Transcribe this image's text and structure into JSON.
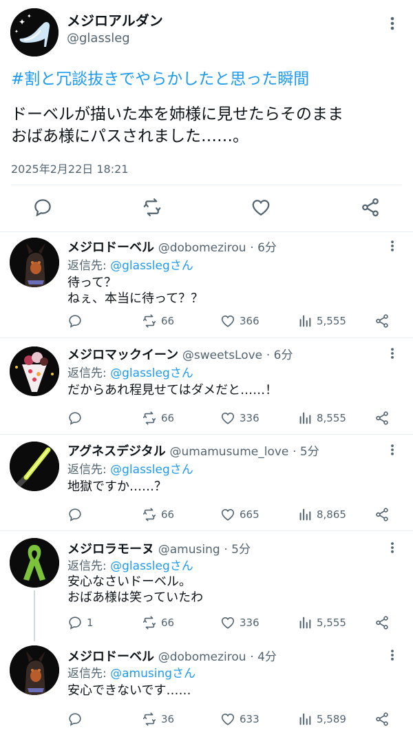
{
  "main": {
    "name": "メジロアルダン",
    "handle": "@glassleg",
    "hashtag": "#割と冗談抜きでやらかしたと思った瞬間",
    "text": "ドーベルが描いた本を姉様に見せたらそのまま\nおばあ様にパスされました……。",
    "timestamp": "2025年2月22日 18:21",
    "icons": [
      "reply-icon",
      "retweet-icon",
      "like-icon",
      "share-icon"
    ]
  },
  "replies": [
    {
      "name": "メジロドーベル",
      "handle": "@dobomezirou",
      "time": "· 6分",
      "reply_prefix": "返信先:",
      "reply_to": "@glasslegさん",
      "text": "待って？\nねぇ、本当に待って？？",
      "replies": "",
      "retweets": "66",
      "likes": "366",
      "views": "5,555"
    },
    {
      "name": "メジロマックイーン",
      "handle": "@sweetsLove",
      "time": "· 6分",
      "reply_prefix": "返信先:",
      "reply_to": "@glasslegさん",
      "text": "だからあれ程見せてはダメだと……！",
      "replies": "",
      "retweets": "66",
      "likes": "336",
      "views": "8,555"
    },
    {
      "name": "アグネスデジタル",
      "handle": "@umamusume_love",
      "time": "· 5分",
      "reply_prefix": "返信先:",
      "reply_to": "@glasslegさん",
      "text": "地獄ですか……？",
      "replies": "",
      "retweets": "66",
      "likes": "665",
      "views": "8,865"
    },
    {
      "name": "メジロラモーヌ",
      "handle": "@amusing",
      "time": "· 5分",
      "reply_prefix": "返信先:",
      "reply_to": "@glasslegさん",
      "text": "安心なさいドーベル。\nおばあ様は笑っていたわ",
      "replies": "1",
      "retweets": "66",
      "likes": "336",
      "views": "5,555"
    },
    {
      "name": "メジロドーベル",
      "handle": "@dobomezirou",
      "time": "· 4分",
      "reply_prefix": "返信先:",
      "reply_to": "@amusingさん",
      "text": "安心できないです……",
      "replies": "",
      "retweets": "36",
      "likes": "633",
      "views": "5,589"
    }
  ],
  "colors": {
    "accent": "#1d9bf0",
    "muted": "#536471",
    "text": "#0f1419",
    "divider": "#e6ecf0"
  }
}
